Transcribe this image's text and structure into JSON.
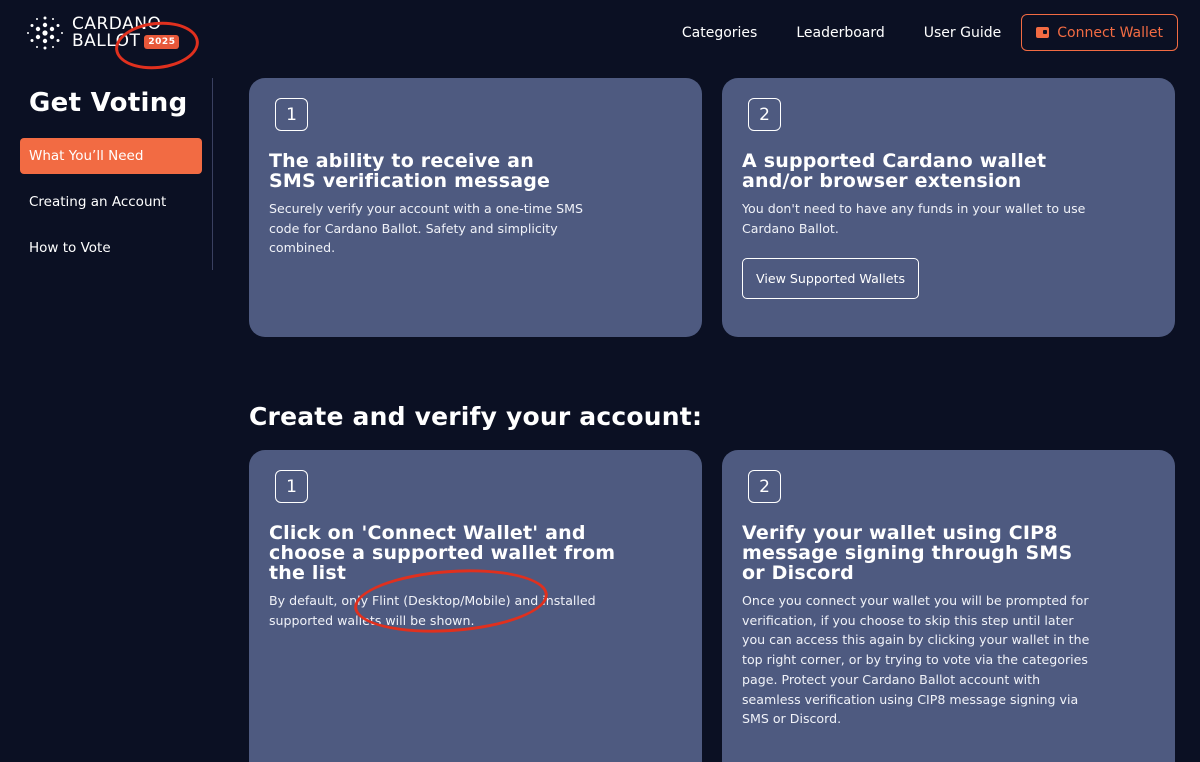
{
  "header": {
    "logo_line1": "CARDANO",
    "logo_line2": "BALLOT",
    "year_badge": "2025",
    "nav": [
      "Categories",
      "Leaderboard",
      "User Guide"
    ],
    "connect_wallet": "Connect Wallet"
  },
  "sidebar": {
    "title": "Get Voting",
    "items": [
      {
        "label": "What You’ll Need",
        "active": true
      },
      {
        "label": "Creating an Account",
        "active": false
      },
      {
        "label": "How to Vote",
        "active": false
      }
    ]
  },
  "needs": [
    {
      "number": "1",
      "title": "The ability to receive an SMS verification message",
      "text": "Securely verify your account with a one-time SMS code for Cardano Ballot. Safety and simplicity combined."
    },
    {
      "number": "2",
      "title": "A supported Cardano wallet and/or browser extension",
      "text": "You don't need to have any funds in your wallet to use Cardano Ballot.",
      "button": "View Supported Wallets"
    }
  ],
  "account_section": {
    "heading": "Create and verify your account:",
    "steps": [
      {
        "number": "1",
        "title": "Click on 'Connect Wallet' and choose a supported wallet from the list",
        "text": "By default, only Flint (Desktop/Mobile) and installed supported wallets will be shown."
      },
      {
        "number": "2",
        "title": "Verify your wallet using CIP8 message signing through SMS or Discord",
        "text": "Once you connect your wallet you will be prompted for verification, if you choose to skip this step until later you can access this again by clicking your wallet in the top right corner, or by trying to vote via the categories page. Protect your Cardano Ballot account with seamless verification using CIP8 message signing via SMS or Discord."
      }
    ]
  },
  "colors": {
    "background": "#0b1023",
    "card": "#4e5a80",
    "accent": "#f26b43",
    "annotation": "#e0301e"
  },
  "icons": [
    "cardano-logo-icon",
    "wallet-icon"
  ]
}
